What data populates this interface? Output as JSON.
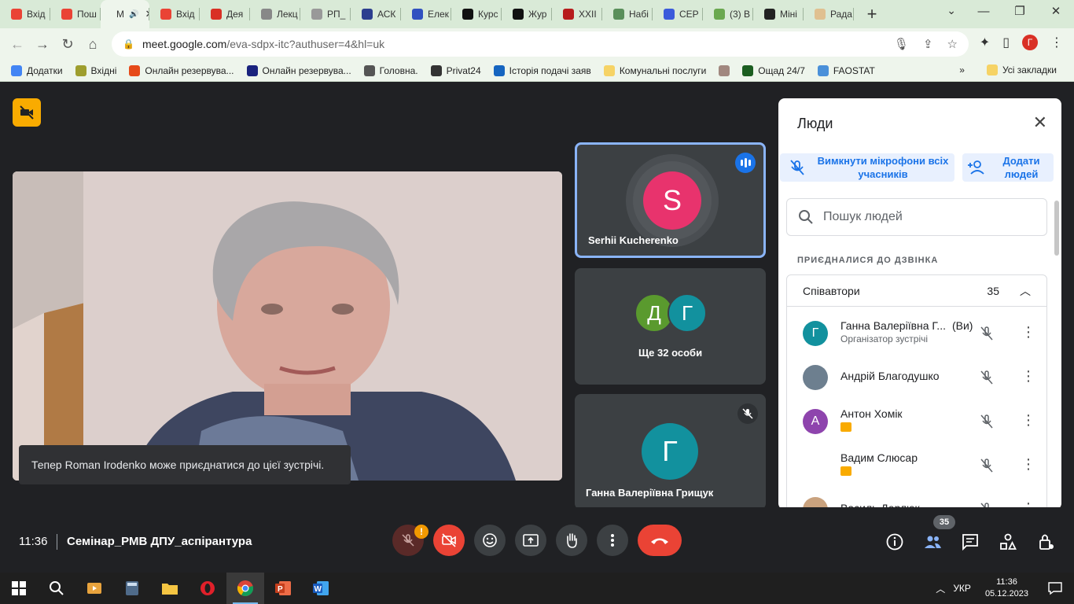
{
  "browser": {
    "tabs": [
      {
        "label": "Вхід",
        "color": "#ea4335"
      },
      {
        "label": "Пош",
        "color": "#ea4335"
      },
      {
        "label": "M",
        "color": "#ffffff",
        "active": true
      },
      {
        "label": "Вхід",
        "color": "#ea4335"
      },
      {
        "label": "Дея",
        "color": "#d93025"
      },
      {
        "label": "Лекц",
        "color": "#888888"
      },
      {
        "label": "РП_",
        "color": "#999999"
      },
      {
        "label": "АСК",
        "color": "#2c3e8f"
      },
      {
        "label": "Елек",
        "color": "#3050c0"
      },
      {
        "label": "Курс",
        "color": "#111111"
      },
      {
        "label": "Жур",
        "color": "#111111"
      },
      {
        "label": "XXII",
        "color": "#b71c1c"
      },
      {
        "label": "Набі",
        "color": "#5a8f5a"
      },
      {
        "label": "СЕР",
        "color": "#3b5bdb"
      },
      {
        "label": "(3) В",
        "color": "#6aa84f"
      },
      {
        "label": "Міні",
        "color": "#222222"
      },
      {
        "label": "Рада",
        "color": "#e0c090"
      }
    ],
    "new_tab": "+",
    "url_host": "meet.google.com",
    "url_path": "/eva-sdpx-itc?authuser=4&hl=uk",
    "profile_letter": "Г",
    "bookmarks": [
      {
        "label": "Додатки",
        "color": "#4285f4"
      },
      {
        "label": "Вхідні",
        "color": "#9e9e2e"
      },
      {
        "label": "Онлайн резервува...",
        "color": "#e64a19"
      },
      {
        "label": "Онлайн резервува...",
        "color": "#1a237e"
      },
      {
        "label": "Головна.",
        "color": "#555555"
      },
      {
        "label": "Privat24",
        "color": "#333333"
      },
      {
        "label": "Історія подачі заяв",
        "color": "#1565c0"
      },
      {
        "label": "Комунальні послуги",
        "color": "#f6d365"
      },
      {
        "label": "",
        "color": "#a1887f"
      },
      {
        "label": "Ощад 24/7",
        "color": "#1b5e20"
      },
      {
        "label": "FAOSTAT",
        "color": "#4a90d9"
      }
    ],
    "bookmarks_more": "»",
    "all_bookmarks": "Усі закладки"
  },
  "meet": {
    "toast": "Тепер Roman Irodenko може приєднатися до цієї зустрічі.",
    "tiles": {
      "speaker_name": "Serhii Kucherenko",
      "speaker_initial": "S",
      "speaker_color": "#e8336d",
      "group_initial_1": "Д",
      "group_color_1": "#5a9a2e",
      "group_initial_2": "Г",
      "group_color_2": "#12919e",
      "group_text": "Ще 32 особи",
      "third_name": "Ганна Валеріївна Грищук",
      "third_initial": "Г",
      "third_color": "#12919e"
    },
    "panel": {
      "title": "Люди",
      "mute_all": "Вимкнути мікрофони всіх учасників",
      "add_people": "Додати людей",
      "search_placeholder": "Пошук людей",
      "joined_label": "ПРИЄДНАЛИСЯ ДО ДЗВІНКА",
      "cohosts_label": "Співавтори",
      "cohosts_count": "35",
      "people": [
        {
          "name": "Ганна Валеріївна Г...",
          "suffix": "(Ви)",
          "sub": "Організатор зустрічі",
          "initial": "Г",
          "color": "#12919e"
        },
        {
          "name": "Андрій Благодушко",
          "sub": "",
          "initial": "",
          "color": "#6d7f8f"
        },
        {
          "name": "Антон Хомік",
          "sub": "",
          "initial": "А",
          "color": "#8e44ad"
        },
        {
          "name": "Вадим Слюсар",
          "sub": "",
          "initial": "",
          "color": "#ffffff"
        },
        {
          "name": "Василь Дерлюк",
          "sub": "",
          "initial": "",
          "color": "#c9a27e"
        }
      ]
    },
    "bottom": {
      "time": "11:36",
      "meeting_name": "Семінар_РМВ ДПУ_аспірантура",
      "mic_warning": "!",
      "people_count": "35"
    }
  },
  "taskbar": {
    "lang": "УКР",
    "time": "11:36",
    "date": "05.12.2023"
  }
}
